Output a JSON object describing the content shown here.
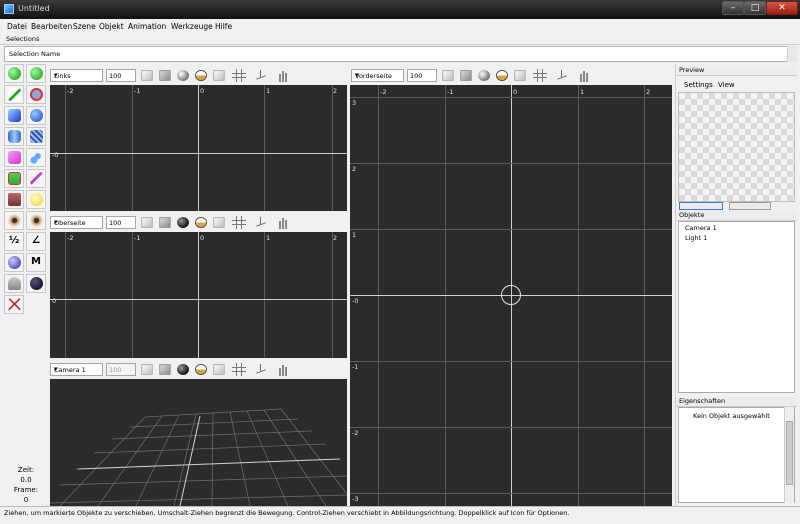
{
  "window": {
    "title": "Untitled",
    "min_glyph": "–",
    "max_glyph": "□",
    "close_glyph": "✕"
  },
  "menu": [
    "Datei",
    "Bearbeiten",
    "Szene",
    "Objekt",
    "Animation",
    "Werkzeuge",
    "Hilfe"
  ],
  "selections_label": "Selections",
  "selection_name_placeholder": "Selection Name",
  "tools": [
    "green-sphere-icon",
    "green-sphere-add-icon",
    "pipette-icon",
    "rotate-icon",
    "blue-cube-icon",
    "blue-sphere-icon",
    "cylinder-icon",
    "grid-icon",
    "pink-cube-icon",
    "drops-icon",
    "image-icon",
    "spline-icon",
    "camera-icon",
    "light-bulb-icon",
    "eye-icon",
    "eye-select-icon",
    "fraction-icon",
    "angle-icon",
    "material-sphere-icon",
    "m-icon",
    "person-icon",
    "dark-object-icon",
    "pyramid-icon"
  ],
  "tool_text": {
    "fraction": "½",
    "angle": "∠",
    "m": "M"
  },
  "viewports": {
    "left": {
      "view": "Links",
      "zoom": "100",
      "xticks": [
        "-2",
        "-1",
        "0",
        "1",
        "2"
      ],
      "yticks": [
        "-0"
      ]
    },
    "top": {
      "view": "Oberseite",
      "zoom": "100",
      "xticks": [
        "-2",
        "-1",
        "0",
        "1",
        "2"
      ],
      "yticks": [
        "0"
      ]
    },
    "camera": {
      "view": "Camera 1",
      "zoom": "100"
    },
    "front": {
      "view": "Vorderseite",
      "zoom": "100",
      "xticks": [
        "-2",
        "-1",
        "0",
        "1",
        "2"
      ],
      "yticks": [
        "3",
        "2",
        "1",
        "-0",
        "-1",
        "-2",
        "-3"
      ]
    }
  },
  "right_panel": {
    "preview_label": "Preview",
    "preview_tabs": [
      "Settings",
      "View"
    ],
    "objects_label": "Objekte",
    "objects": [
      "Camera 1",
      "Light 1"
    ],
    "properties_label": "Eigenschaften",
    "properties_empty": "Kein Objekt ausgewählt"
  },
  "time": {
    "zeit_label": "Zeit:",
    "zeit_value": "0.0",
    "frame_label": "Frame:",
    "frame_value": "0"
  },
  "status": "Ziehen, um markierte Objekte zu verschieben. Umschalt-Ziehen begrenzt die Bewegung. Control-Ziehen verschiebt in Abbildungsrichtung. Doppelklick auf Icon für Optionen.",
  "colors": {
    "viewport_bg": "#2b2b2b",
    "grid_line": "#5c5c5c",
    "grid_center": "#cfcfcf"
  }
}
